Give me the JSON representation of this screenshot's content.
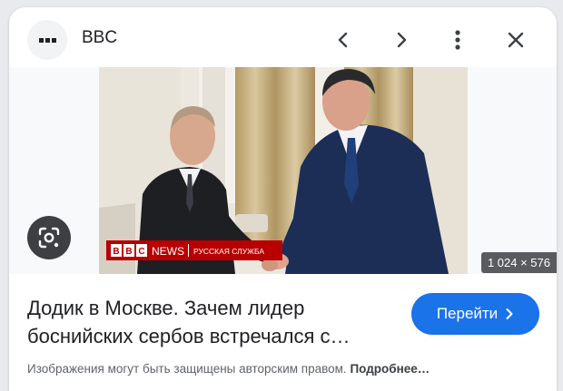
{
  "header": {
    "site_name": "BBC",
    "icons": [
      "site-favicon",
      "chevron-left-icon",
      "chevron-right-icon",
      "more-vert-icon",
      "close-icon"
    ]
  },
  "image": {
    "dimensions": "1 024 × 576",
    "logo": {
      "brand": "BBC",
      "service": "NEWS",
      "subtitle": "РУССКАЯ СЛУЖБА"
    }
  },
  "result": {
    "title_line1": "Додик в Москве. Зачем лидер",
    "title_line2": "боснийских сербов встречался с…"
  },
  "action": {
    "visit_label": "Перейти"
  },
  "footer": {
    "notice": "Изображения могут быть защищены авторским правом.",
    "more_link": "Подробнее…"
  },
  "colors": {
    "accent": "#1a73e8",
    "bbc_red": "#b80000"
  }
}
